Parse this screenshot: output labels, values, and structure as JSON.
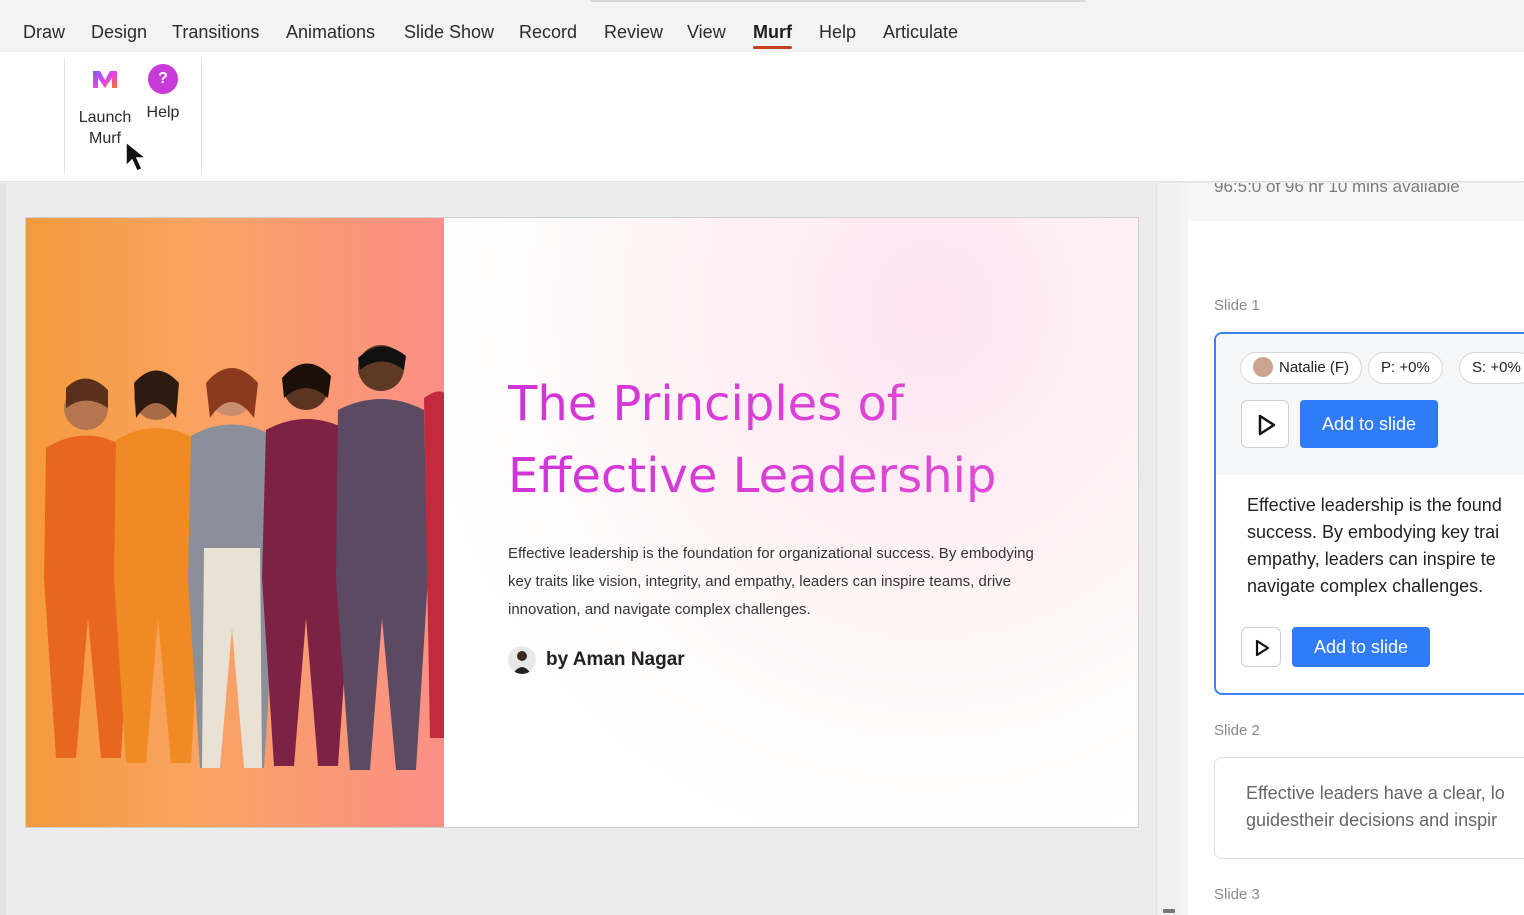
{
  "tabs": [
    {
      "label": "Draw"
    },
    {
      "label": "Design"
    },
    {
      "label": "Transitions"
    },
    {
      "label": "Animations"
    },
    {
      "label": "Slide Show"
    },
    {
      "label": "Record"
    },
    {
      "label": "Review"
    },
    {
      "label": "View"
    },
    {
      "label": "Murf",
      "active": true
    },
    {
      "label": "Help"
    },
    {
      "label": "Articulate"
    }
  ],
  "ribbon": {
    "launch_line1": "Launch",
    "launch_line2": "Murf",
    "help_label": "Help",
    "help_glyph": "?"
  },
  "slide": {
    "title_line1": "The Principles of",
    "title_line2": "Effective Leadership",
    "body_line1": "Effective leadership is the foundation for organizational success. By embodying",
    "body_line2": "key traits like vision, integrity, and empathy, leaders can inspire teams, drive",
    "body_line3": "innovation, and navigate complex challenges.",
    "author": "by Aman Nagar",
    "title_color": "#d53ed8"
  },
  "panel": {
    "quota": "96:5:0 of 96 hr 10 mins available",
    "slide1_label": "Slide 1",
    "voice": "Natalie (F)",
    "pitch": "P: +0%",
    "speed": "S: +0%",
    "add_to_slide": "Add to slide",
    "script_lines": "Effective leadership is the found\nsuccess. By embodying key trai\nempathy, leaders can inspire te\nnavigate complex challenges.",
    "slide2_label": "Slide 2",
    "slide2_text": "Effective leaders have a clear, lo\nguidestheir decisions and inspir",
    "slide3_label": "Slide 3",
    "accent": "#2f7cf6"
  }
}
